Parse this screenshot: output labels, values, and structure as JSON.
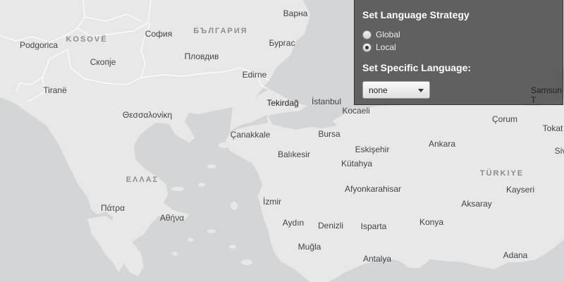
{
  "map": {
    "colors": {
      "land": "#e8e8e8",
      "sea": "#d3d5d6",
      "border": "#ffffff",
      "panel": "#505050"
    },
    "countries": [
      {
        "id": "kosovo",
        "label": "KOSOVË"
      },
      {
        "id": "bulgaria",
        "label": "БЪЛГАРИЯ"
      },
      {
        "id": "greece",
        "label": "ΕΛΛΑΣ"
      },
      {
        "id": "turkey",
        "label": "TÜRKIYE"
      }
    ],
    "cities": [
      {
        "id": "varna",
        "label": "Варна"
      },
      {
        "id": "sofia",
        "label": "София"
      },
      {
        "id": "burgas",
        "label": "Бургас"
      },
      {
        "id": "podgorica",
        "label": "Podgorica"
      },
      {
        "id": "skopje",
        "label": "Скопје"
      },
      {
        "id": "plovdiv",
        "label": "Пловдив"
      },
      {
        "id": "tirane",
        "label": "Tiranë"
      },
      {
        "id": "edirne",
        "label": "Edirne"
      },
      {
        "id": "tekirdag",
        "label": "Tekirdağ"
      },
      {
        "id": "istanbul",
        "label": "İstanbul"
      },
      {
        "id": "kocaeli",
        "label": "Kocaeli"
      },
      {
        "id": "thessaloniki",
        "label": "Θεσσαλονίκη"
      },
      {
        "id": "corum",
        "label": "Çorum"
      },
      {
        "id": "tokat",
        "label": "Tokat"
      },
      {
        "id": "canakkale",
        "label": "Çanakkale"
      },
      {
        "id": "bursa",
        "label": "Bursa"
      },
      {
        "id": "balikesir",
        "label": "Balıkesir"
      },
      {
        "id": "eskisehir",
        "label": "Eskişehir"
      },
      {
        "id": "ankara",
        "label": "Ankara"
      },
      {
        "id": "kutahya",
        "label": "Kütahya"
      },
      {
        "id": "afyon",
        "label": "Afyonkarahisar"
      },
      {
        "id": "kayseri",
        "label": "Kayseri"
      },
      {
        "id": "izmir",
        "label": "İzmir"
      },
      {
        "id": "aksaray",
        "label": "Aksaray"
      },
      {
        "id": "patra",
        "label": "Πάτρα"
      },
      {
        "id": "athina",
        "label": "Αθήνα"
      },
      {
        "id": "aydin",
        "label": "Aydın"
      },
      {
        "id": "denizli",
        "label": "Denizli"
      },
      {
        "id": "isparta",
        "label": "Isparta"
      },
      {
        "id": "konya",
        "label": "Konya"
      },
      {
        "id": "mugla",
        "label": "Muğla"
      },
      {
        "id": "antalya",
        "label": "Antalya"
      },
      {
        "id": "adana",
        "label": "Adana"
      },
      {
        "id": "sivas_partial",
        "label": "Siv"
      }
    ]
  },
  "panel": {
    "strategy_title": "Set Language Strategy",
    "options": [
      {
        "label": "Global",
        "checked": false
      },
      {
        "label": "Local",
        "checked": true
      }
    ],
    "specific_title": "Set Specific Language:",
    "select_value": "none",
    "samsun_label": "Samsun T"
  }
}
